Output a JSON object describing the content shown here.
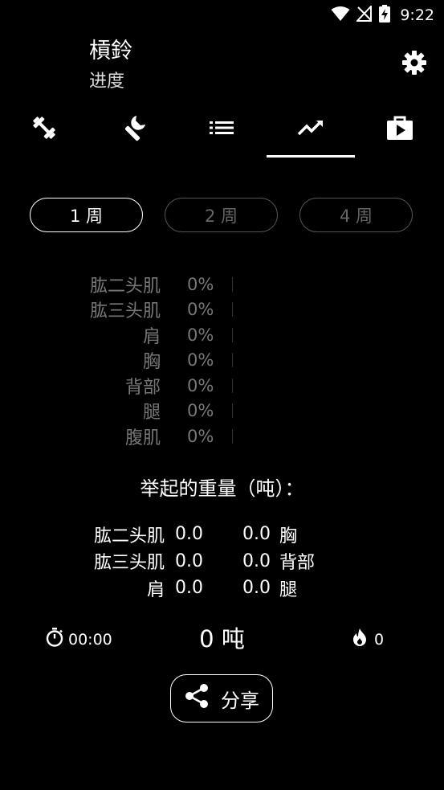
{
  "status_bar": {
    "time": "9:22"
  },
  "header": {
    "title": "槓鈴",
    "subtitle": "进度"
  },
  "tabs": [
    {
      "icon": "dumbbell-icon"
    },
    {
      "icon": "wrench-icon"
    },
    {
      "icon": "list-icon"
    },
    {
      "icon": "trending-up-icon",
      "active": true
    },
    {
      "icon": "play-briefcase-icon"
    }
  ],
  "period": {
    "options": [
      "1 周",
      "2 周",
      "4 周"
    ],
    "selected": 0
  },
  "muscles": [
    {
      "name": "肱二头肌",
      "percent": "0%"
    },
    {
      "name": "肱三头肌",
      "percent": "0%"
    },
    {
      "name": "肩",
      "percent": "0%"
    },
    {
      "name": "胸",
      "percent": "0%"
    },
    {
      "name": "背部",
      "percent": "0%"
    },
    {
      "name": "腿",
      "percent": "0%"
    },
    {
      "name": "腹肌",
      "percent": "0%"
    }
  ],
  "weight_heading": "举起的重量（吨）：",
  "weight_rows": [
    {
      "left_name": "肱二头肌",
      "left_value": "0.0",
      "right_value": "0.0",
      "right_name": "胸"
    },
    {
      "left_name": "肱三头肌",
      "left_value": "0.0",
      "right_value": "0.0",
      "right_name": "背部"
    },
    {
      "left_name": "肩",
      "left_value": "0.0",
      "right_value": "0.0",
      "right_name": "腿"
    }
  ],
  "stats": {
    "duration": "00:00",
    "total": "0 吨",
    "calories": "0"
  },
  "share_label": "分享"
}
